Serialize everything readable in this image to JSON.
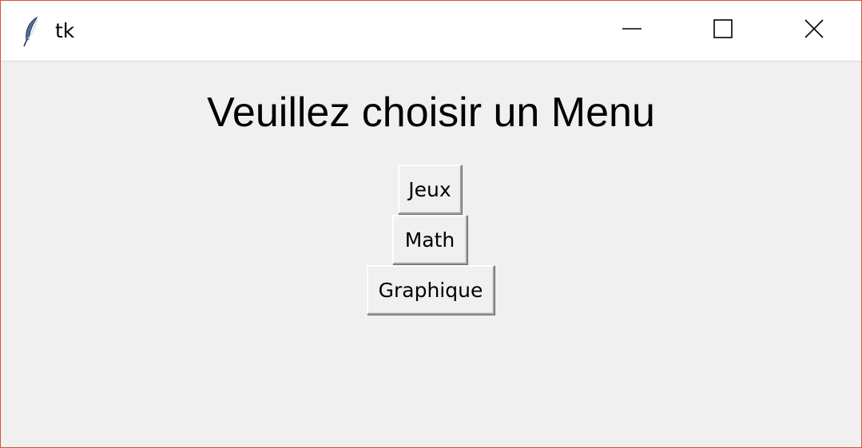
{
  "window": {
    "title": "tk",
    "icon": "feather-icon",
    "controls": {
      "minimize": "minimize-icon",
      "maximize": "maximize-icon",
      "close": "close-icon"
    },
    "border_color": "#d9542b"
  },
  "main": {
    "heading": "Veuillez choisir un Menu",
    "buttons": [
      {
        "label": "Jeux"
      },
      {
        "label": "Math"
      },
      {
        "label": "Graphique"
      }
    ]
  },
  "colors": {
    "background": "#f0f0f0",
    "titlebar": "#ffffff"
  }
}
